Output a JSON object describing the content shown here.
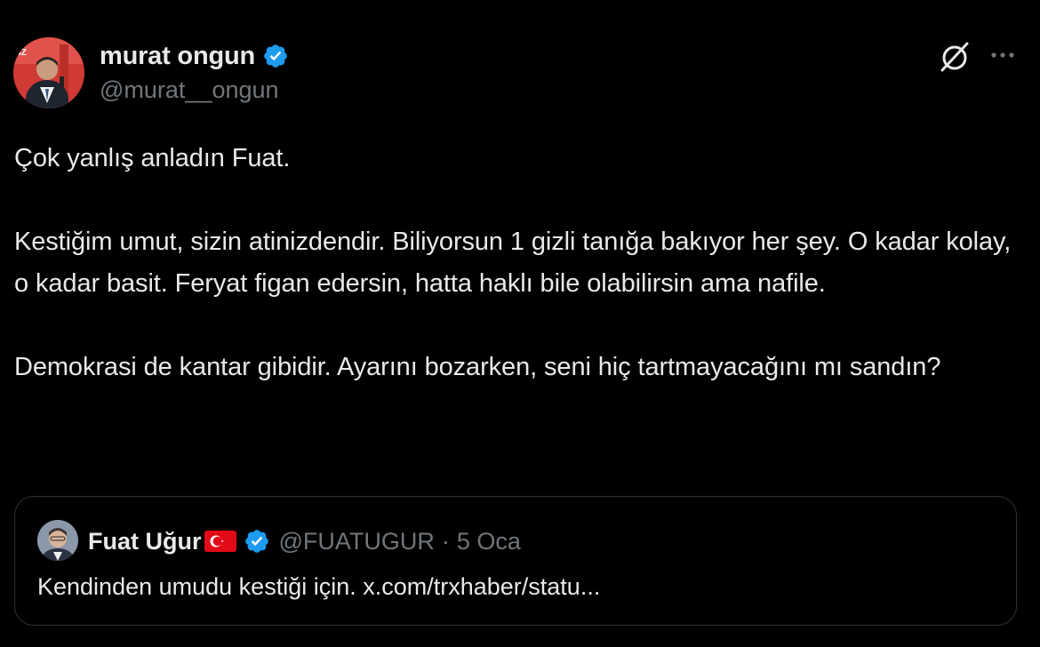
{
  "tweet": {
    "author": {
      "display_name": "murat ongun",
      "handle": "@murat__ongun",
      "verified": true
    },
    "icons": {
      "grok": "grok-icon",
      "more": "more-horizontal-icon"
    },
    "paragraphs": [
      "Çok yanlış anladın Fuat.",
      "Kestiğim umut, sizin atinizdendir. Biliyorsun 1 gizli tanığa bakıyor her şey. O kadar kolay, o kadar basit. Feryat figan edersin, hatta haklı bile olabilirsin ama nafile.",
      "Demokrasi de kantar gibidir. Ayarını bozarken, seni hiç tartmayacağını mı sandın?"
    ]
  },
  "quote": {
    "author": {
      "display_name": "Fuat Uğur",
      "flag": "turkey-flag-emoji",
      "verified": true,
      "handle": "@FUATUGUR",
      "separator": "·",
      "date": "5 Oca"
    },
    "text": "Kendinden umudu kestiği için. x.com/trxhaber/statu..."
  },
  "colors": {
    "background": "#000000",
    "primary_text": "#e7e9ea",
    "secondary_text": "#71767b",
    "verified_blue": "#1d9bf0",
    "border": "#2f3336"
  }
}
